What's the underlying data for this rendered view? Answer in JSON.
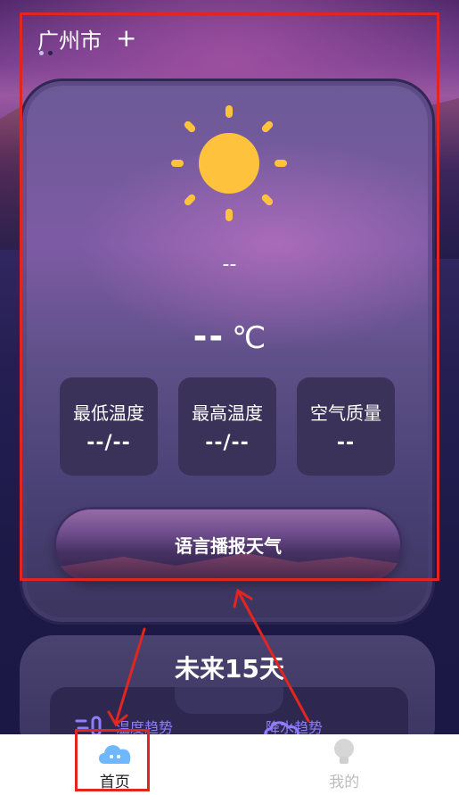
{
  "header": {
    "city": "广州市",
    "add_label": "+"
  },
  "weather": {
    "icon": "sun-icon",
    "description": "--",
    "temperature": "--",
    "unit": "℃"
  },
  "stats": [
    {
      "label": "最低温度",
      "value": "--/--"
    },
    {
      "label": "最高温度",
      "value": "--/--"
    },
    {
      "label": "空气质量",
      "value": "--"
    }
  ],
  "voice_button": {
    "label": "语言播报天气"
  },
  "forecast": {
    "title": "未来15天",
    "temperature_trend": "温度趋势",
    "precipitation_trend": "降水趋势"
  },
  "tabs": [
    {
      "label": "首页",
      "icon": "cloud-icon"
    },
    {
      "label": "我的",
      "icon": "bulb-icon"
    }
  ],
  "colors": {
    "annotation": "#e2261f",
    "accent": "#8f7cff",
    "sun": "#ffc23d"
  }
}
